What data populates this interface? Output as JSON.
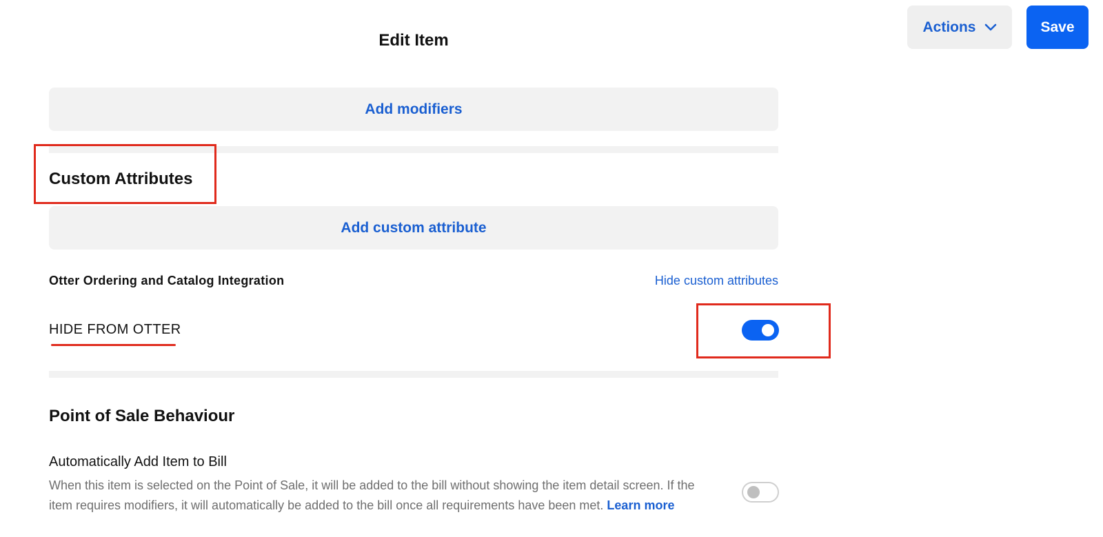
{
  "header": {
    "title": "Edit Item",
    "actions_label": "Actions",
    "actions_icon": "chevron-down-icon",
    "save_label": "Save"
  },
  "modifiers": {
    "add_label": "Add modifiers"
  },
  "custom_attributes": {
    "heading": "Custom Attributes",
    "add_label": "Add custom attribute",
    "group_label": "Otter Ordering and Catalog Integration",
    "hide_link": "Hide custom attributes",
    "attribute_label": "HIDE FROM OTTER",
    "attribute_enabled": true
  },
  "pos_behaviour": {
    "heading": "Point of Sale Behaviour",
    "setting_title": "Automatically Add Item to Bill",
    "setting_description": "When this item is selected on the Point of Sale, it will be added to the bill without showing the item detail screen. If the item requires modifiers, it will automatically be added to the bill once all requirements have been met.",
    "learn_more": "Learn more",
    "setting_enabled": false
  },
  "colors": {
    "accent": "#0b63f2",
    "link": "#1a5fd1",
    "annotation": "#e02a1c"
  }
}
